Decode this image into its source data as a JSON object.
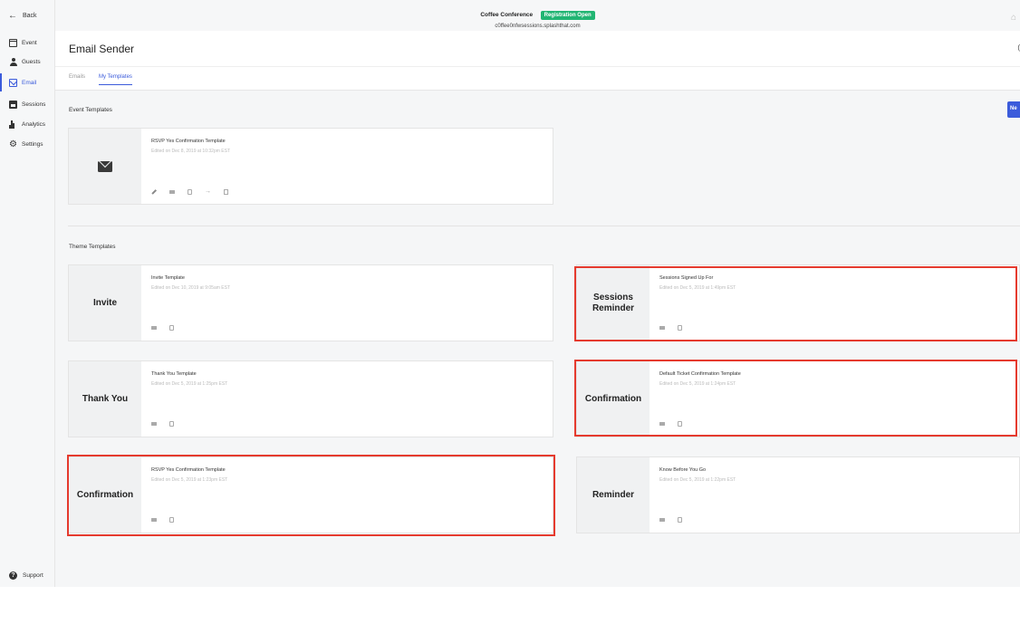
{
  "sidebar": {
    "back_label": "Back",
    "items": [
      {
        "label": "Event",
        "icon": "calendar-icon"
      },
      {
        "label": "Guests",
        "icon": "person-icon"
      },
      {
        "label": "Email",
        "icon": "mail-icon",
        "active": true
      },
      {
        "label": "Sessions",
        "icon": "sessions-icon"
      },
      {
        "label": "Analytics",
        "icon": "bar-chart-icon"
      },
      {
        "label": "Settings",
        "icon": "gear-icon"
      }
    ],
    "support_label": "Support"
  },
  "topbar": {
    "event_name": "Coffee Conference",
    "status_badge": "Registration Open",
    "event_url": "c0ffee0nfwsessions.splashthat.com"
  },
  "page": {
    "title": "Email Sender",
    "tabs": [
      {
        "label": "Emails",
        "active": false
      },
      {
        "label": "My Templates",
        "active": true
      }
    ],
    "new_button_label": "Ne"
  },
  "event_templates": {
    "section_title": "Event Templates",
    "cards": [
      {
        "name": "RSVP Yes Confirmation Template",
        "edited": "Edited on Dec 8, 2019 at 10:32pm EST",
        "thumb": "envelope-icon"
      }
    ]
  },
  "theme_templates": {
    "section_title": "Theme Templates",
    "cards": [
      {
        "thumb": "Invite",
        "name": "Invite Template",
        "edited": "Edited on Dec 10, 2019 at 9:05am EST",
        "highlighted": false
      },
      {
        "thumb_line1": "Sessions",
        "thumb_line2": "Reminder",
        "name": "Sessions Signed Up For",
        "edited": "Edited on Dec 5, 2019 at 1:49pm EST",
        "highlighted": true
      },
      {
        "thumb": "Thank You",
        "name": "Thank You Template",
        "edited": "Edited on Dec 5, 2019 at 1:25pm EST",
        "highlighted": false
      },
      {
        "thumb": "Confirmation",
        "name": "Default Ticket Confirmation Template",
        "edited": "Edited on Dec 5, 2019 at 1:24pm EST",
        "highlighted": true
      },
      {
        "thumb": "Confirmation",
        "name": "RSVP Yes Confirmation Template",
        "edited": "Edited on Dec 5, 2019 at 1:23pm EST",
        "highlighted": true
      },
      {
        "thumb": "Reminder",
        "name": "Know Before You Go",
        "edited": "Edited on Dec 5, 2019 at 1:22pm EST",
        "highlighted": false
      }
    ]
  },
  "colors": {
    "accent": "#3b5bdb",
    "badge_green": "#22b573",
    "highlight_red": "#e53a2e"
  }
}
